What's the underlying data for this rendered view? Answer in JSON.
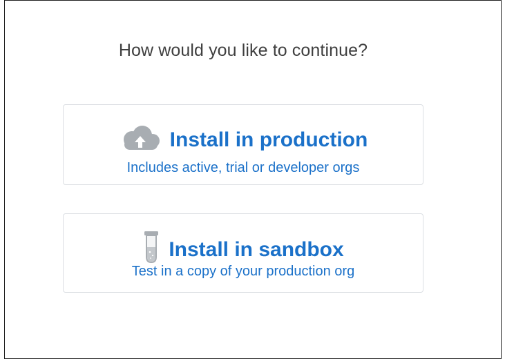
{
  "dialog": {
    "heading": "How would you like to continue?"
  },
  "options": [
    {
      "icon": "cloud-upload-icon",
      "title": "Install in production",
      "subtitle": "Includes active, trial or developer orgs"
    },
    {
      "icon": "test-tube-icon",
      "title": "Install in sandbox",
      "subtitle": "Test in a copy of your production org"
    }
  ],
  "colors": {
    "accent": "#1b71c9",
    "heading": "#3f3f3f",
    "card_border": "#dcdfe3",
    "icon_gray": "#a8adb2"
  }
}
